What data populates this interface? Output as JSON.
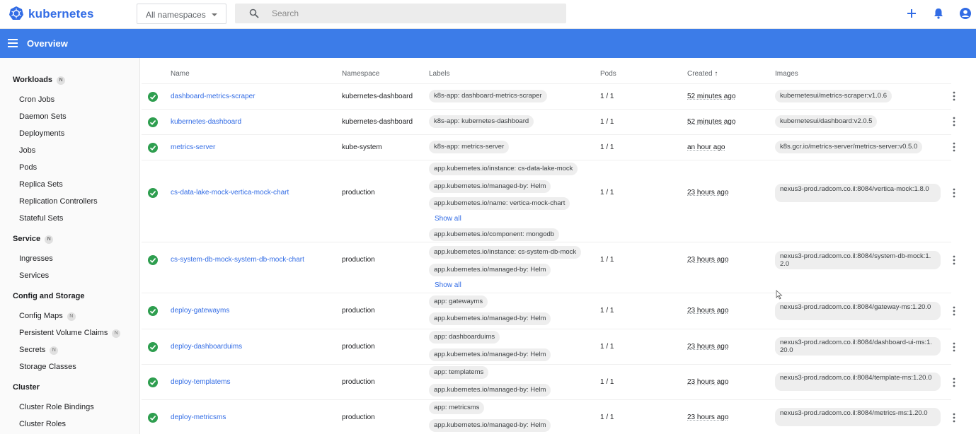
{
  "app": {
    "name": "kubernetes"
  },
  "topbar": {
    "namespace_value": "All namespaces",
    "search_placeholder": "Search"
  },
  "page": {
    "title": "Overview"
  },
  "sidebar": {
    "workloads": "Workloads",
    "workloads_badge": "N",
    "workload_items": [
      "Cron Jobs",
      "Daemon Sets",
      "Deployments",
      "Jobs",
      "Pods",
      "Replica Sets",
      "Replication Controllers",
      "Stateful Sets"
    ],
    "service": "Service",
    "service_badge": "N",
    "service_items": [
      "Ingresses",
      "Services"
    ],
    "config": "Config and Storage",
    "config_items": [
      "Config Maps",
      "Persistent Volume Claims",
      "Secrets",
      "Storage Classes"
    ],
    "config_badges": [
      "N",
      "N",
      "N"
    ],
    "cluster": "Cluster",
    "cluster_items": [
      "Cluster Role Bindings",
      "Cluster Roles"
    ]
  },
  "table": {
    "columns": [
      "Name",
      "Namespace",
      "Labels",
      "Pods",
      "Created",
      "Images"
    ],
    "sort_arrow": "↑",
    "show_all": "Show all",
    "rows": [
      {
        "name": "dashboard-metrics-scraper",
        "namespace": "kubernetes-dashboard",
        "labels": [
          "k8s-app: dashboard-metrics-scraper"
        ],
        "pods": "1 / 1",
        "created": "52 minutes ago",
        "image": "kubernetesui/metrics-scraper:v1.0.6",
        "status": "running"
      },
      {
        "name": "kubernetes-dashboard",
        "namespace": "kubernetes-dashboard",
        "labels": [
          "k8s-app: kubernetes-dashboard"
        ],
        "pods": "1 / 1",
        "created": "52 minutes ago",
        "image": "kubernetesui/dashboard:v2.0.5",
        "status": "running"
      },
      {
        "name": "metrics-server",
        "namespace": "kube-system",
        "labels": [
          "k8s-app: metrics-server"
        ],
        "pods": "1 / 1",
        "created": "an hour ago",
        "image": "k8s.gcr.io/metrics-server/metrics-server:v0.5.0",
        "status": "running"
      },
      {
        "name": "cs-data-lake-mock-vertica-mock-chart",
        "namespace": "production",
        "labels": [
          "app.kubernetes.io/instance: cs-data-lake-mock",
          "app.kubernetes.io/managed-by: Helm",
          "app.kubernetes.io/name: vertica-mock-chart"
        ],
        "pods": "1 / 1",
        "created": "23 hours ago",
        "image": "nexus3-prod.radcom.co.il:8084/vertica-mock:1.8.0",
        "status": "running"
      },
      {
        "name": "cs-system-db-mock-system-db-mock-chart",
        "namespace": "production",
        "labels": [
          "app.kubernetes.io/component: mongodb",
          "app.kubernetes.io/instance: cs-system-db-mock",
          "app.kubernetes.io/managed-by: Helm"
        ],
        "pods": "1 / 1",
        "created": "23 hours ago",
        "image": "nexus3-prod.radcom.co.il:8084/system-db-mock:1.2.0",
        "status": "running"
      },
      {
        "name": "deploy-gatewayms",
        "namespace": "production",
        "labels": [
          "app: gatewayms",
          "app.kubernetes.io/managed-by: Helm"
        ],
        "pods": "1 / 1",
        "created": "23 hours ago",
        "image": "nexus3-prod.radcom.co.il:8084/gateway-ms:1.20.0",
        "status": "running"
      },
      {
        "name": "deploy-dashboarduims",
        "namespace": "production",
        "labels": [
          "app: dashboarduims",
          "app.kubernetes.io/managed-by: Helm"
        ],
        "pods": "1 / 1",
        "created": "23 hours ago",
        "image": "nexus3-prod.radcom.co.il:8084/dashboard-ui-ms:1.20.0",
        "status": "running"
      },
      {
        "name": "deploy-templatems",
        "namespace": "production",
        "labels": [
          "app: templatems",
          "app.kubernetes.io/managed-by: Helm"
        ],
        "pods": "1 / 1",
        "created": "23 hours ago",
        "image": "nexus3-prod.radcom.co.il:8084/template-ms:1.20.0",
        "status": "running"
      },
      {
        "name": "deploy-metricsms",
        "namespace": "production",
        "labels": [
          "app: metricsms",
          "app.kubernetes.io/managed-by: Helm"
        ],
        "pods": "1 / 1",
        "created": "23 hours ago",
        "image": "nexus3-prod.radcom.co.il:8084/metrics-ms:1.20.0",
        "status": "running"
      }
    ]
  },
  "colors": {
    "brand": "#326ce5",
    "header_bar": "#3c7ce8",
    "ok": "#2e9e4f"
  }
}
